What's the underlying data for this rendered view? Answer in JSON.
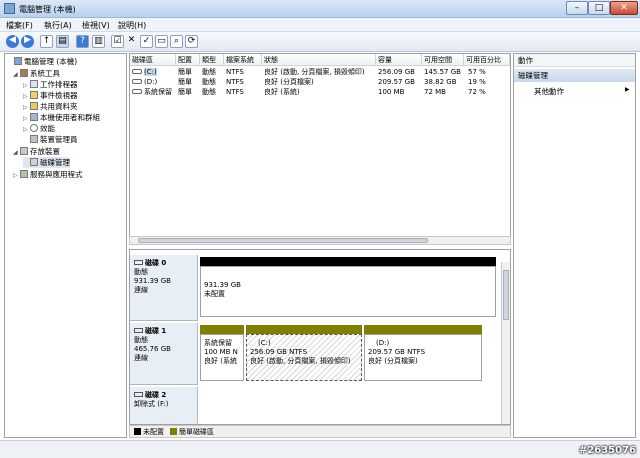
{
  "window": {
    "title": "電腦管理 (本機)"
  },
  "menu": [
    "檔案(F)",
    "執行(A)",
    "檢視(V)",
    "說明(H)"
  ],
  "tree": [
    {
      "label": "電腦管理 (本機)",
      "level": 0,
      "exp": ""
    },
    {
      "label": "系統工具",
      "level": 1,
      "exp": "◢"
    },
    {
      "label": "工作排程器",
      "level": 2,
      "exp": "▷"
    },
    {
      "label": "事件檢視器",
      "level": 2,
      "exp": "▷"
    },
    {
      "label": "共用資料夾",
      "level": 2,
      "exp": "▷"
    },
    {
      "label": "本機使用者和群組",
      "level": 2,
      "exp": "▷"
    },
    {
      "label": "效能",
      "level": 2,
      "exp": "▷"
    },
    {
      "label": "裝置管理員",
      "level": 2,
      "exp": ""
    },
    {
      "label": "存放裝置",
      "level": 1,
      "exp": "◢"
    },
    {
      "label": "磁碟管理",
      "level": 2,
      "exp": ""
    },
    {
      "label": "服務與應用程式",
      "level": 1,
      "exp": "▷"
    }
  ],
  "volume_table": {
    "headers": [
      "磁碟區",
      "配置",
      "類型",
      "檔案系統",
      "狀態",
      "容量",
      "可用空間",
      "可用百分比"
    ],
    "rows": [
      [
        "(C:)",
        "簡單",
        "動態",
        "NTFS",
        "良好 (啟動, 分頁檔案, 損毀傾印)",
        "256.09 GB",
        "145.57 GB",
        "57 %"
      ],
      [
        "(D:)",
        "簡單",
        "動態",
        "NTFS",
        "良好 (分頁檔案)",
        "209.57 GB",
        "38.82 GB",
        "19 %"
      ],
      [
        "系統保留",
        "簡單",
        "動態",
        "NTFS",
        "良好 (系統)",
        "100 MB",
        "72 MB",
        "72 %"
      ]
    ]
  },
  "actions": {
    "header": "動作",
    "selected": "磁碟管理",
    "more": "其他動作",
    "more_arrow": "▶"
  },
  "disks": [
    {
      "name": "磁碟 0",
      "type": "動態",
      "size": "931.39 GB",
      "status": "連線",
      "partitions": [
        {
          "size": "931.39 GB",
          "status": "未配置"
        }
      ]
    },
    {
      "name": "磁碟 1",
      "type": "動態",
      "size": "465.76 GB",
      "status": "連線",
      "partitions": [
        {
          "name": "系統保留",
          "size": "100 MB N",
          "status": "良好 (系統"
        },
        {
          "name": "(C:)",
          "size": "256.09 GB NTFS",
          "status": "良好 (啟動, 分頁檔案, 損毀傾印)"
        },
        {
          "name": "(D:)",
          "size": "209.57 GB NTFS",
          "status": "良好 (分頁檔案)"
        }
      ]
    },
    {
      "name": "磁碟 2",
      "type": "卸除式 (F:)"
    }
  ],
  "legend": [
    {
      "label": "未配置",
      "color": "#000000"
    },
    {
      "label": "簡單磁碟區",
      "color": "#808000"
    }
  ],
  "watermark": "#2635076",
  "colors": {
    "unallocated": "#000000",
    "simple_volume": "#808000",
    "selection": "#c8d8ec"
  }
}
